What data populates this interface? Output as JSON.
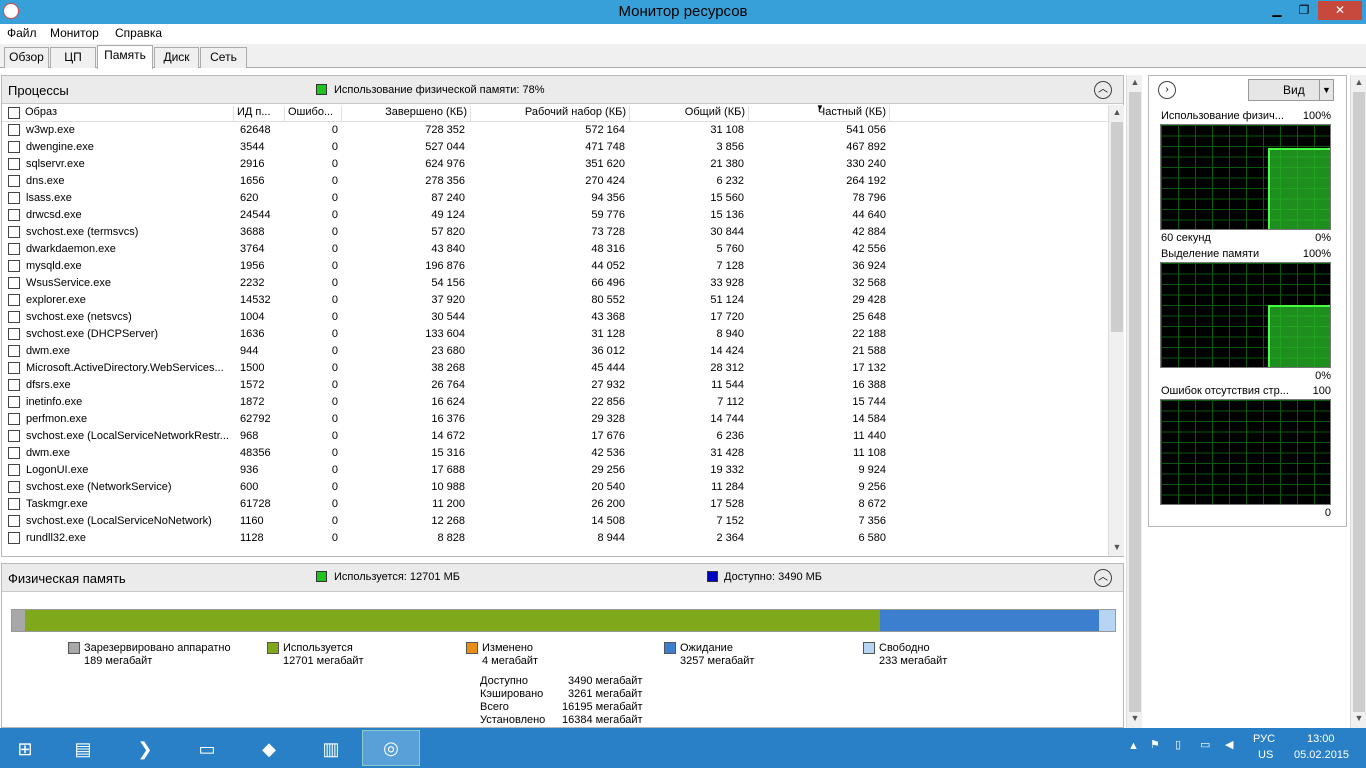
{
  "window": {
    "title": "Монитор ресурсов",
    "min": "▁",
    "max": "❐",
    "close": "✕"
  },
  "menu": [
    "Файл",
    "Монитор",
    "Справка"
  ],
  "tabs": [
    "Обзор",
    "ЦП",
    "Память",
    "Диск",
    "Сеть"
  ],
  "processes": {
    "title": "Процессы",
    "usage": "Использование физической памяти: 78%",
    "usage_color": "#1ec31e",
    "columns": [
      "Образ",
      "ИД п...",
      "Ошибо...",
      "Завершено (КБ)",
      "Рабочий набор (КБ)",
      "Общий (КБ)",
      "Частный (КБ)"
    ],
    "rows": [
      [
        "w3wp.exe",
        "62648",
        "0",
        "728 352",
        "572 164",
        "31 108",
        "541 056"
      ],
      [
        "dwengine.exe",
        "3544",
        "0",
        "527 044",
        "471 748",
        "3 856",
        "467 892"
      ],
      [
        "sqlservr.exe",
        "2916",
        "0",
        "624 976",
        "351 620",
        "21 380",
        "330 240"
      ],
      [
        "dns.exe",
        "1656",
        "0",
        "278 356",
        "270 424",
        "6 232",
        "264 192"
      ],
      [
        "lsass.exe",
        "620",
        "0",
        "87 240",
        "94 356",
        "15 560",
        "78 796"
      ],
      [
        "drwcsd.exe",
        "24544",
        "0",
        "49 124",
        "59 776",
        "15 136",
        "44 640"
      ],
      [
        "svchost.exe (termsvcs)",
        "3688",
        "0",
        "57 820",
        "73 728",
        "30 844",
        "42 884"
      ],
      [
        "dwarkdaemon.exe",
        "3764",
        "0",
        "43 840",
        "48 316",
        "5 760",
        "42 556"
      ],
      [
        "mysqld.exe",
        "1956",
        "0",
        "196 876",
        "44 052",
        "7 128",
        "36 924"
      ],
      [
        "WsusService.exe",
        "2232",
        "0",
        "54 156",
        "66 496",
        "33 928",
        "32 568"
      ],
      [
        "explorer.exe",
        "14532",
        "0",
        "37 920",
        "80 552",
        "51 124",
        "29 428"
      ],
      [
        "svchost.exe (netsvcs)",
        "1004",
        "0",
        "30 544",
        "43 368",
        "17 720",
        "25 648"
      ],
      [
        "svchost.exe (DHCPServer)",
        "1636",
        "0",
        "133 604",
        "31 128",
        "8 940",
        "22 188"
      ],
      [
        "dwm.exe",
        "944",
        "0",
        "23 680",
        "36 012",
        "14 424",
        "21 588"
      ],
      [
        "Microsoft.ActiveDirectory.WebServices...",
        "1500",
        "0",
        "38 268",
        "45 444",
        "28 312",
        "17 132"
      ],
      [
        "dfsrs.exe",
        "1572",
        "0",
        "26 764",
        "27 932",
        "11 544",
        "16 388"
      ],
      [
        "inetinfo.exe",
        "1872",
        "0",
        "16 624",
        "22 856",
        "7 112",
        "15 744"
      ],
      [
        "perfmon.exe",
        "62792",
        "0",
        "16 376",
        "29 328",
        "14 744",
        "14 584"
      ],
      [
        "svchost.exe (LocalServiceNetworkRestr...",
        "968",
        "0",
        "14 672",
        "17 676",
        "6 236",
        "11 440"
      ],
      [
        "dwm.exe",
        "48356",
        "0",
        "15 316",
        "42 536",
        "31 428",
        "11 108"
      ],
      [
        "LogonUI.exe",
        "936",
        "0",
        "17 688",
        "29 256",
        "19 332",
        "9 924"
      ],
      [
        "svchost.exe (NetworkService)",
        "600",
        "0",
        "10 988",
        "20 540",
        "11 284",
        "9 256"
      ],
      [
        "Taskmgr.exe",
        "61728",
        "0",
        "11 200",
        "26 200",
        "17 528",
        "8 672"
      ],
      [
        "svchost.exe (LocalServiceNoNetwork)",
        "1160",
        "0",
        "12 268",
        "14 508",
        "7 152",
        "7 356"
      ],
      [
        "rundll32.exe",
        "1128",
        "0",
        "8 828",
        "8 944",
        "2 364",
        "6 580"
      ]
    ]
  },
  "physical": {
    "title": "Физическая память",
    "used": "Используется: 12701 МБ",
    "used_color": "#1ec31e",
    "avail": "Доступно: 3490 МБ",
    "avail_color": "#0000c0",
    "bar": {
      "reserved": 189,
      "used": 12701,
      "modified": 4,
      "standby": 3257,
      "free": 233
    },
    "legend": [
      {
        "name": "Зарезервировано аппаратно",
        "value": "189 мегабайт",
        "color": "#a8a8a8"
      },
      {
        "name": "Используется",
        "value": "12701 мегабайт",
        "color": "#7fa81a"
      },
      {
        "name": "Изменено",
        "value": "4 мегабайт",
        "color": "#e88e14"
      },
      {
        "name": "Ожидание",
        "value": "3257 мегабайт",
        "color": "#3c7fcf"
      },
      {
        "name": "Свободно",
        "value": "233 мегабайт",
        "color": "#b8d4f4"
      }
    ],
    "stats": [
      {
        "k": "Доступно",
        "v": "3490 мегабайт"
      },
      {
        "k": "Кэшировано",
        "v": "3261 мегабайт"
      },
      {
        "k": "Всего",
        "v": "16195 мегабайт"
      },
      {
        "k": "Установлено",
        "v": "16384 мегабайт"
      }
    ]
  },
  "side": {
    "view": "Вид",
    "graphs": [
      {
        "label": "Использование физич...",
        "max": "100%",
        "bottom_left": "60 секунд",
        "bottom_right": "0%",
        "level": 0.78
      },
      {
        "label": "Выделение памяти",
        "max": "100%",
        "bottom_left": "",
        "bottom_right": "0%",
        "level": 0.6
      },
      {
        "label": "Ошибок отсутствия стр...",
        "max": "100",
        "bottom_left": "",
        "bottom_right": "0",
        "level": 0
      }
    ]
  },
  "taskbar": {
    "lang": "РУС",
    "layout": "US",
    "time": "13:00",
    "date": "05.02.2015"
  }
}
